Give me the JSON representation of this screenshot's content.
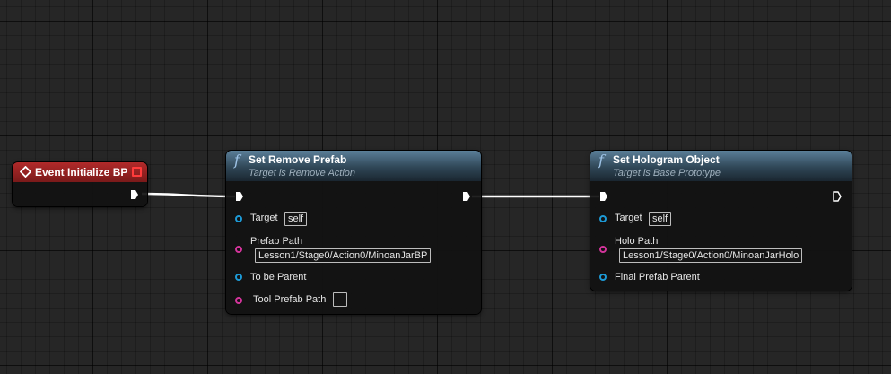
{
  "event_node": {
    "title": "Event Initialize BP"
  },
  "remove_prefab_node": {
    "title": "Set Remove Prefab",
    "subtitle": "Target is Remove Action",
    "pins": {
      "target_label": "Target",
      "target_value": "self",
      "prefab_path_label": "Prefab Path",
      "prefab_path_value": "Lesson1/Stage0/Action0/MinoanJarBP",
      "to_be_parent_label": "To be Parent",
      "tool_prefab_path_label": "Tool Prefab Path",
      "tool_prefab_path_value": ""
    }
  },
  "hologram_node": {
    "title": "Set Hologram Object",
    "subtitle": "Target is Base Prototype",
    "pins": {
      "target_label": "Target",
      "target_value": "self",
      "holo_path_label": "Holo Path",
      "holo_path_value": "Lesson1/Stage0/Action0/MinoanJarHolo",
      "final_prefab_parent_label": "Final Prefab Parent"
    }
  },
  "colors": {
    "background": "#262626",
    "event_header": "#8a1f1f",
    "function_header": "#3d5a6e",
    "object_pin": "#1d9ad6",
    "string_pin": "#d3349b",
    "exec_wire": "#ffffff"
  }
}
